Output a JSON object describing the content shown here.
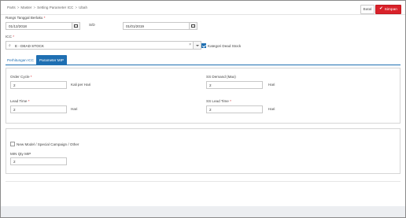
{
  "breadcrumb": [
    "Parts",
    "Master",
    "Setting Parameter ICC",
    "Ubah"
  ],
  "toolbar": {
    "cancel_label": "Batal",
    "save_label": "Simpan"
  },
  "form": {
    "date_range_label": "Rangs Tanggal Berlaku",
    "required_mark": "*",
    "date_from": "01/12/2018",
    "date_to_label": "S/D",
    "date_to": "01/01/2019",
    "icc_label": "ICC",
    "icc_value": "E - DEAD STOCK",
    "dead_stock_label": "Kategori Dead Stock",
    "dead_stock_checked": true
  },
  "tabs": [
    {
      "label": "Perhitungan ICC",
      "active": false
    },
    {
      "label": "Parameter MIP",
      "active": true
    }
  ],
  "params": {
    "order_cycle_label": "Order Cycle",
    "order_cycle_value": "2",
    "order_cycle_unit": "Kali per Hari",
    "ss_demand_label": "SS Demand (Max)",
    "ss_demand_value": "2",
    "ss_demand_unit": "Hari",
    "lead_time_label": "Lead Time",
    "lead_time_value": "2",
    "lead_time_unit": "Hari",
    "ss_lead_time_label": "SS Lead Time",
    "ss_lead_time_value": "2",
    "ss_lead_time_unit": "Hari"
  },
  "special": {
    "new_model_label": "New Model / Special Campaign / Other",
    "new_model_checked": false,
    "min_qty_label": "MIN Qty MIP",
    "min_qty_value": "2"
  },
  "colors": {
    "accent": "#1f6fb2",
    "save": "#d9222a"
  },
  "icons": {
    "calendar": "calendar-icon",
    "search": "search-icon",
    "clear": "clear-icon",
    "dropdown": "chevron-down-icon"
  }
}
